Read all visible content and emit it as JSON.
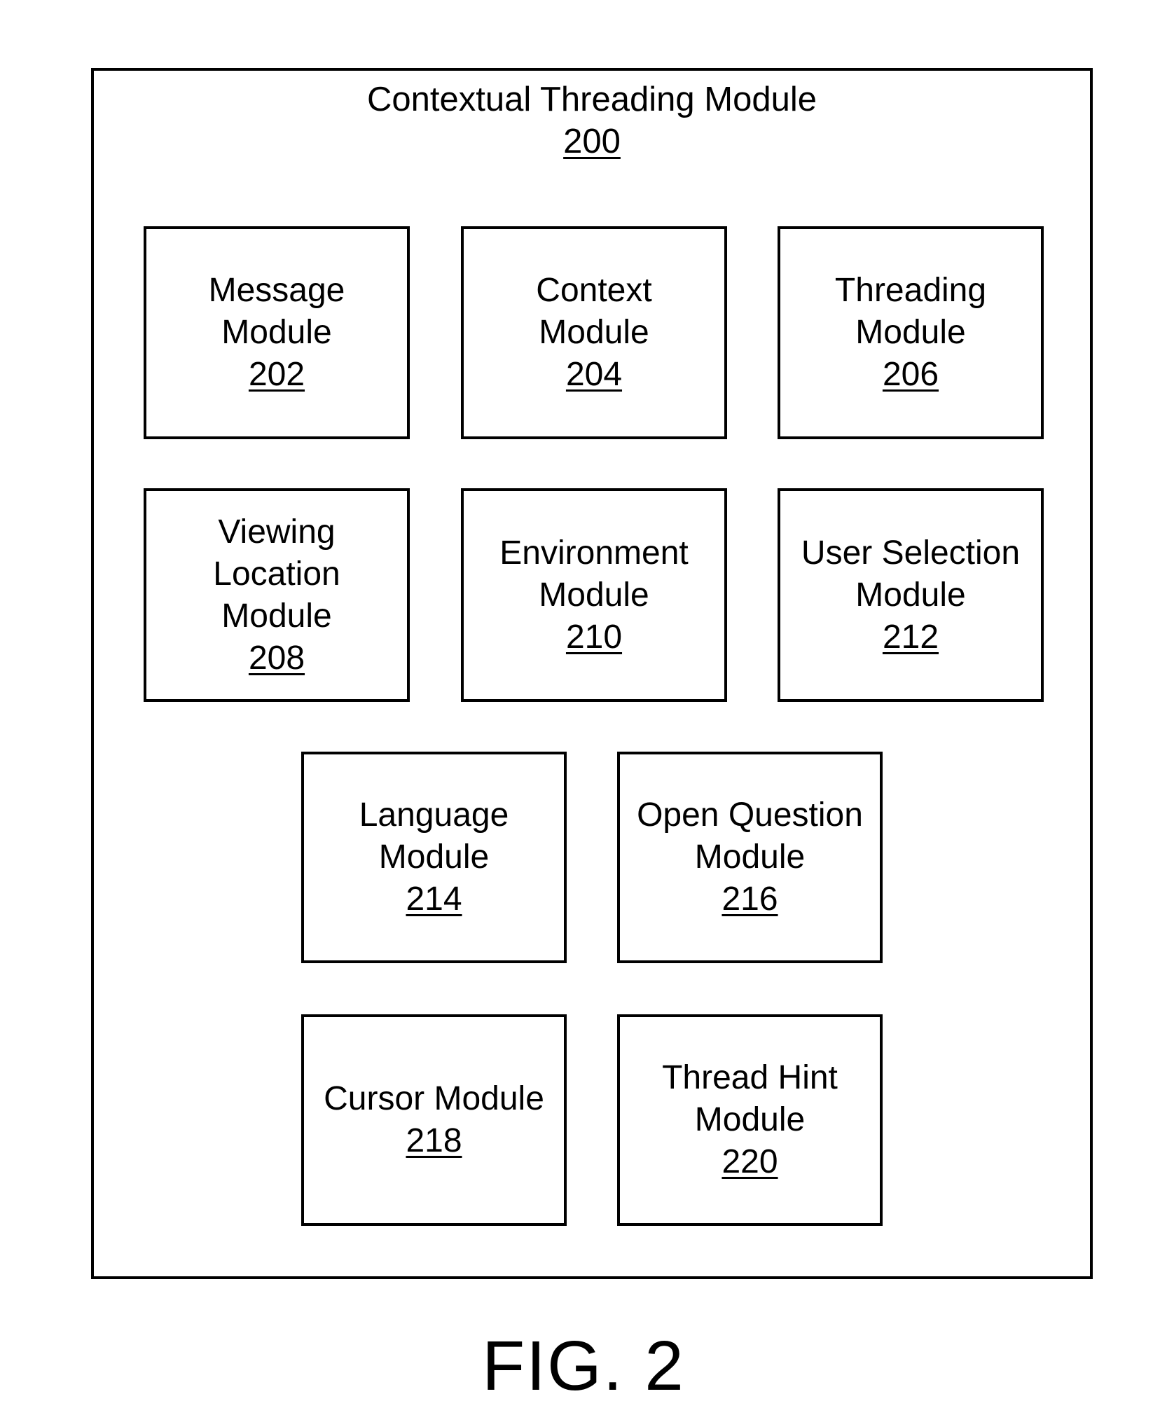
{
  "container": {
    "title": "Contextual Threading Module",
    "ref": "200"
  },
  "modules": [
    {
      "lines": [
        "Message",
        "Module"
      ],
      "ref": "202"
    },
    {
      "lines": [
        "Context",
        "Module"
      ],
      "ref": "204"
    },
    {
      "lines": [
        "Threading",
        "Module"
      ],
      "ref": "206"
    },
    {
      "lines": [
        "Viewing",
        "Location",
        "Module"
      ],
      "ref": "208"
    },
    {
      "lines": [
        "Environment",
        "Module"
      ],
      "ref": "210"
    },
    {
      "lines": [
        "User Selection",
        "Module"
      ],
      "ref": "212"
    },
    {
      "lines": [
        "Language",
        "Module"
      ],
      "ref": "214"
    },
    {
      "lines": [
        "Open Question",
        "Module"
      ],
      "ref": "216"
    },
    {
      "lines": [
        "Cursor Module"
      ],
      "ref": "218"
    },
    {
      "lines": [
        "Thread Hint",
        "Module"
      ],
      "ref": "220"
    }
  ],
  "figure_label": "FIG. 2"
}
